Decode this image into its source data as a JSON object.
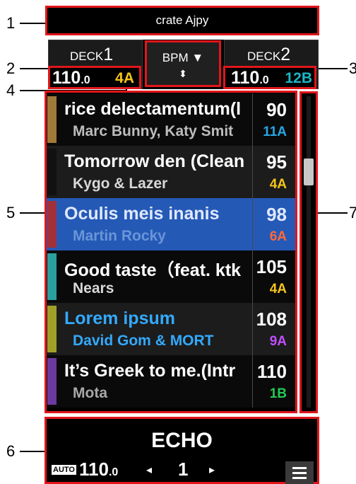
{
  "title_bar": {
    "text": "crate Ajpy"
  },
  "deck1": {
    "label": "DECK",
    "number": "1",
    "bpm_int": "110",
    "bpm_dec": ".0",
    "key": "4A",
    "key_color": "#f5c518"
  },
  "deck2": {
    "label": "DECK",
    "number": "2",
    "bpm_int": "110",
    "bpm_dec": ".0",
    "key": "12B",
    "key_color": "#19b7c8"
  },
  "sort": {
    "label": "BPM ▼",
    "arrows": "⬍"
  },
  "tracks": [
    {
      "title": "rice delectamentum(l",
      "artist": "Marc Bunny, Katy Smit",
      "bpm": "90",
      "key": "11A",
      "color": "#a07a38",
      "title_color": "#ffffff",
      "artist_color": "#bdbdbd",
      "bpm_color": "#ffffff",
      "key_color": "#27a7e6",
      "bg": "#0a0a0a",
      "highlighted": false
    },
    {
      "title": "Tomorrow den (Clean",
      "artist": "Kygo & Lazer",
      "bpm": "95",
      "key": "4A",
      "color": "#111111",
      "title_color": "#ffffff",
      "artist_color": "#d8d8d8",
      "bpm_color": "#ffffff",
      "key_color": "#f5c518",
      "bg": "#1c1c1c",
      "highlighted": false
    },
    {
      "title": "Oculis meis inanis",
      "artist": "Martin Rocky",
      "bpm": "98",
      "key": "6A",
      "color": "#a0303a",
      "title_color": "#dfe8ff",
      "artist_color": "#6a95d8",
      "bpm_color": "#dfe8ff",
      "key_color": "#ff6a3a",
      "bg": "#2559b6",
      "highlighted": true
    },
    {
      "title": "Good taste（feat. ktk",
      "artist": "Nears",
      "bpm": "105",
      "key": "4A",
      "color": "#2a9fa0",
      "title_color": "#ffffff",
      "artist_color": "#d8d8d8",
      "bpm_color": "#ffffff",
      "key_color": "#f5c518",
      "bg": "#0a0a0a",
      "highlighted": false
    },
    {
      "title": "Lorem ipsum",
      "artist": "David Gom & MORT",
      "bpm": "108",
      "key": "9A",
      "color": "#a0a028",
      "title_color": "#33aaff",
      "artist_color": "#33aaff",
      "bpm_color": "#ffffff",
      "key_color": "#c050ff",
      "bg": "#1c1c1c",
      "highlighted": false
    },
    {
      "title": "It’s Greek to me.(Intr",
      "artist": "Mota",
      "bpm": "110",
      "key": "1B",
      "color": "#6a3aa0",
      "title_color": "#ffffff",
      "artist_color": "#a8a8a8",
      "bpm_color": "#ffffff",
      "key_color": "#22cc55",
      "bg": "#0a0a0a",
      "highlighted": false
    }
  ],
  "effect": {
    "name": "ECHO",
    "auto_label": "AUTO",
    "bpm_int": "110",
    "bpm_dec": ".0",
    "prev_arrow": "◂",
    "beat": "1",
    "next_arrow": "▸"
  },
  "callouts": [
    "1",
    "2",
    "3",
    "4",
    "5",
    "6",
    "7"
  ],
  "accent_color": "#e0161b"
}
